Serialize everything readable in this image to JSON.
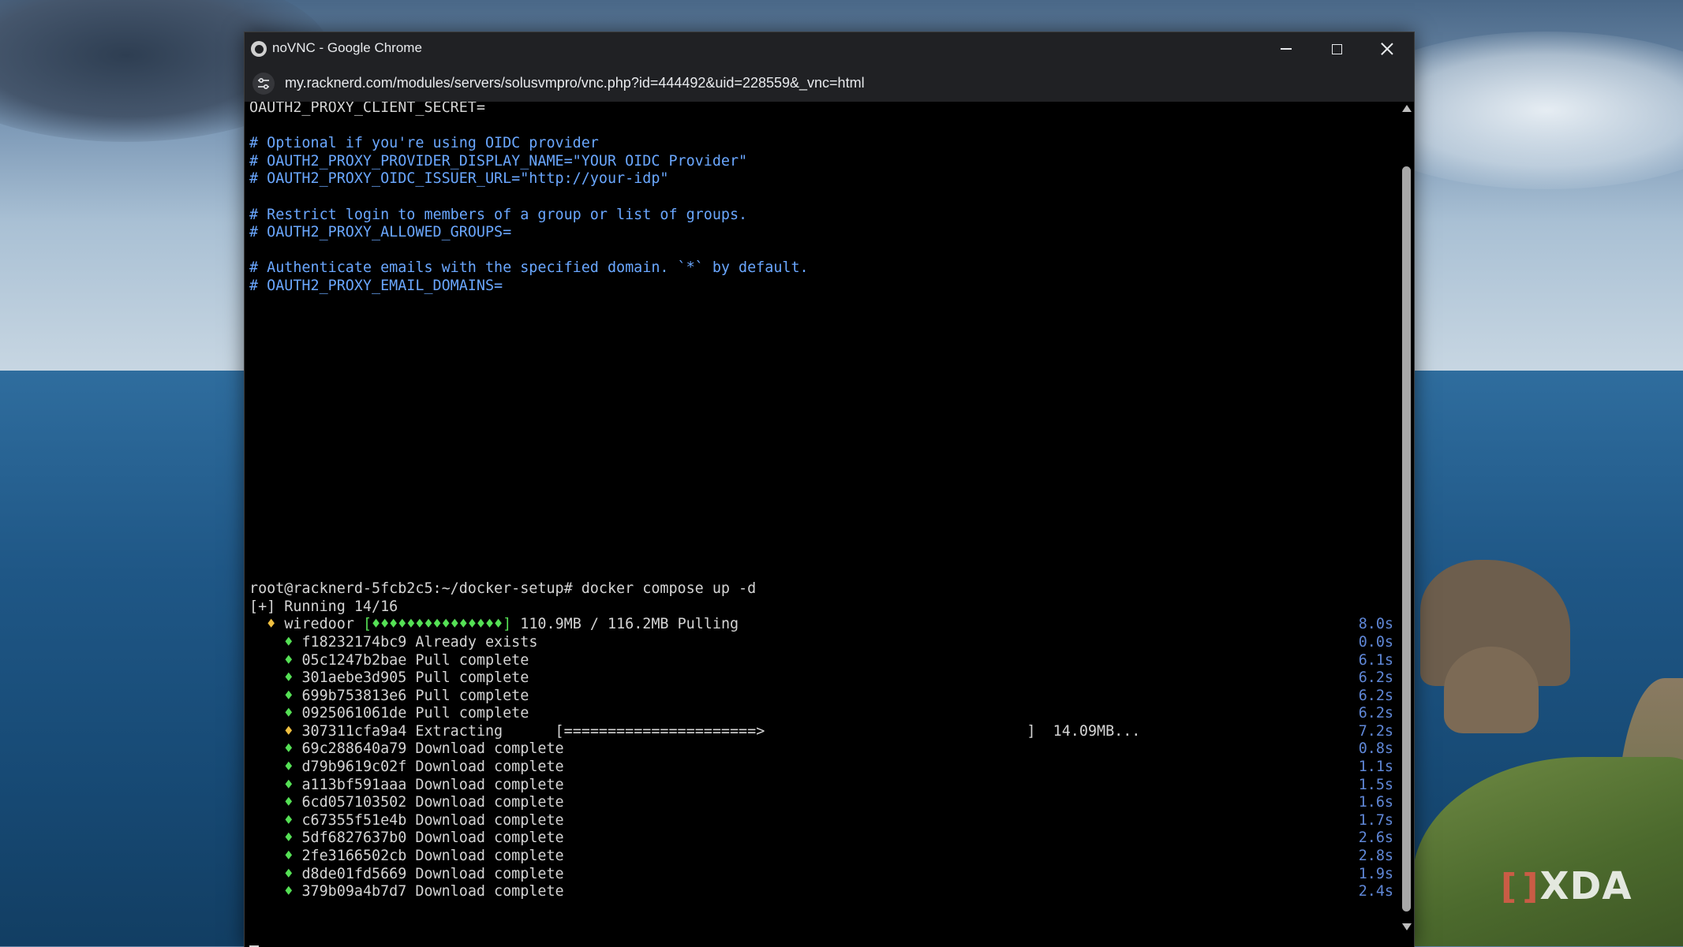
{
  "window": {
    "title": "noVNC - Google Chrome",
    "url": "my.racknerd.com/modules/servers/solusvmpro/vnc.php?id=444492&uid=228559&_vnc=html"
  },
  "watermark": {
    "mark": "[ ]",
    "text": "XDA"
  },
  "terminal": {
    "lines": [
      {
        "text": "OAUTH2_PROXY_CLIENT_SECRET=",
        "style": "white"
      },
      {
        "text": "",
        "style": "white"
      },
      {
        "text": "# Optional if you're using OIDC provider",
        "style": "comment"
      },
      {
        "text": "# OAUTH2_PROXY_PROVIDER_DISPLAY_NAME=\"YOUR OIDC Provider\"",
        "style": "comment"
      },
      {
        "text": "# OAUTH2_PROXY_OIDC_ISSUER_URL=\"http://your-idp\"",
        "style": "comment"
      },
      {
        "text": "",
        "style": "white"
      },
      {
        "text": "# Restrict login to members of a group or list of groups.",
        "style": "comment"
      },
      {
        "text": "# OAUTH2_PROXY_ALLOWED_GROUPS=",
        "style": "comment"
      },
      {
        "text": "",
        "style": "white"
      },
      {
        "text": "# Authenticate emails with the specified domain. `*` by default.",
        "style": "comment"
      },
      {
        "text": "# OAUTH2_PROXY_EMAIL_DOMAINS=",
        "style": "comment"
      }
    ],
    "command": "root@racknerd-5fcb2c5:~/docker-setup# docker compose up -d",
    "running": "[+] Running 14/16",
    "pull": {
      "bullet": "♦",
      "name": "wiredoor",
      "bar": "[♦♦♦♦♦♦♦♦♦♦♦♦♦♦♦]",
      "progress": "110.9MB / 116.2MB",
      "status": "Pulling",
      "time": "8.0s"
    },
    "layers": [
      {
        "bullet": "♦",
        "color": "green",
        "text": "f18232174bc9 Already exists",
        "time": "0.0s"
      },
      {
        "bullet": "♦",
        "color": "green",
        "text": "05c1247b2bae Pull complete",
        "time": "6.1s"
      },
      {
        "bullet": "♦",
        "color": "green",
        "text": "301aebe3d905 Pull complete",
        "time": "6.2s"
      },
      {
        "bullet": "♦",
        "color": "green",
        "text": "699b753813e6 Pull complete",
        "time": "6.2s"
      },
      {
        "bullet": "♦",
        "color": "green",
        "text": "0925061061de Pull complete",
        "time": "6.2s"
      },
      {
        "bullet": "♦",
        "color": "yellow",
        "text": "307311cfa9a4 Extracting      [======================>                              ]  14.09MB...",
        "time": "7.2s"
      },
      {
        "bullet": "♦",
        "color": "green",
        "text": "69c288640a79 Download complete",
        "time": "0.8s"
      },
      {
        "bullet": "♦",
        "color": "green",
        "text": "d79b9619c02f Download complete",
        "time": "1.1s"
      },
      {
        "bullet": "♦",
        "color": "green",
        "text": "a113bf591aaa Download complete",
        "time": "1.5s"
      },
      {
        "bullet": "♦",
        "color": "green",
        "text": "6cd057103502 Download complete",
        "time": "1.6s"
      },
      {
        "bullet": "♦",
        "color": "green",
        "text": "c67355f51e4b Download complete",
        "time": "1.7s"
      },
      {
        "bullet": "♦",
        "color": "green",
        "text": "5df6827637b0 Download complete",
        "time": "2.6s"
      },
      {
        "bullet": "♦",
        "color": "green",
        "text": "2fe3166502cb Download complete",
        "time": "2.8s"
      },
      {
        "bullet": "♦",
        "color": "green",
        "text": "d8de01fd5669 Download complete",
        "time": "1.9s"
      },
      {
        "bullet": "♦",
        "color": "green",
        "text": "379b09a4b7d7 Download complete",
        "time": "2.4s"
      }
    ]
  },
  "colors": {
    "comment": "#6aa7ff",
    "time": "#5f87d7",
    "done_bullet": "#55e055",
    "active_bullet": "#f0c040"
  }
}
